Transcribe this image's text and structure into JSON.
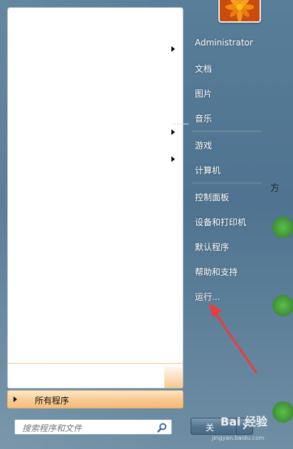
{
  "user_picture": {
    "icon": "flower-icon",
    "colors": [
      "#f07a12",
      "#ffb400"
    ]
  },
  "right_column": {
    "items": [
      {
        "label": "Administrator"
      },
      {
        "label": "文档"
      },
      {
        "label": "图片"
      },
      {
        "label": "音乐"
      },
      {
        "label": "游戏"
      },
      {
        "label": "计算机"
      },
      {
        "label": "控制面板"
      },
      {
        "label": "设备和打印机"
      },
      {
        "label": "默认程序"
      },
      {
        "label": "帮助和支持"
      },
      {
        "label": "运行..."
      }
    ]
  },
  "left_pane": {
    "all_programs_label": "所有程序"
  },
  "search": {
    "placeholder": "搜索程序和文件",
    "icon": "search-icon"
  },
  "shutdown": {
    "label": "关",
    "icon": "chevron-right-icon"
  },
  "desktop_edge": {
    "text": "方"
  },
  "watermark": {
    "brand": "Bai 经验",
    "url": "jingyan.baidu.com"
  },
  "annotation": {
    "icon": "red-arrow-icon",
    "color": "#f23a3a"
  }
}
